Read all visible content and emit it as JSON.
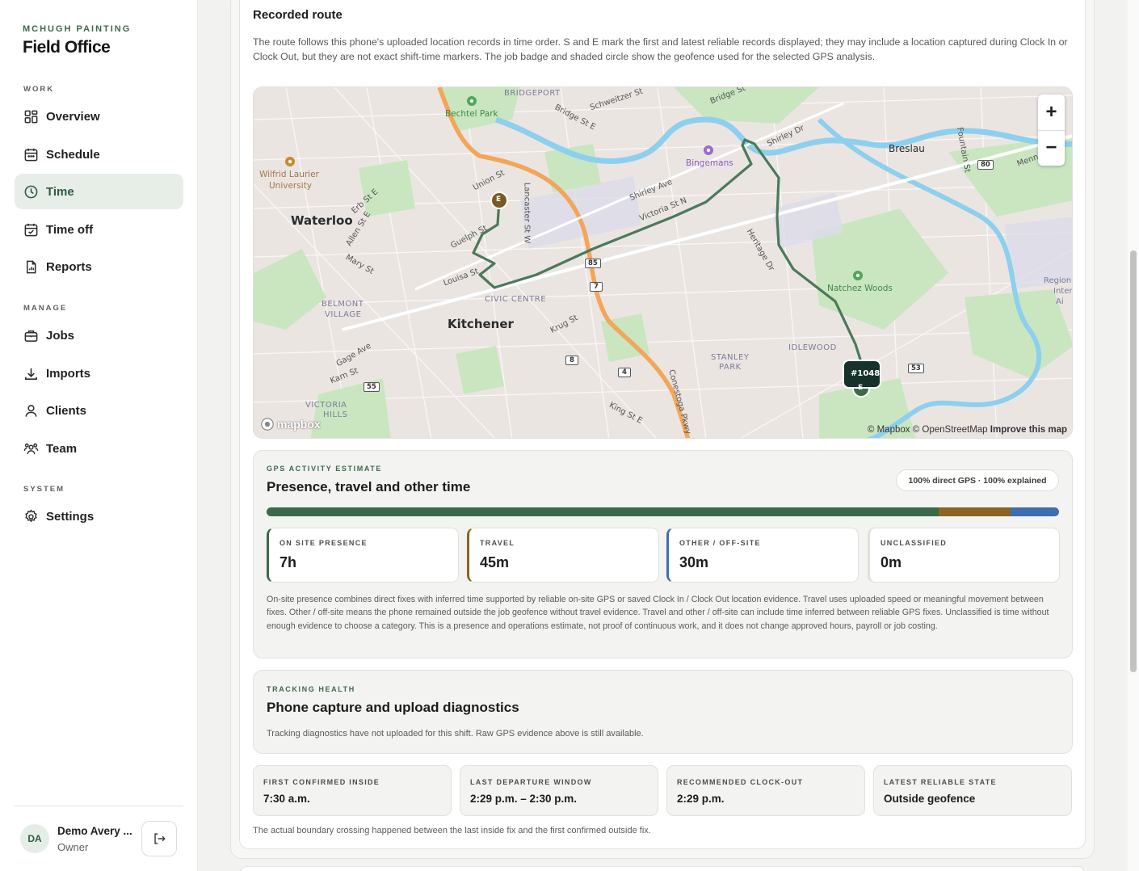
{
  "sidebar": {
    "company": "MCHUGH PAINTING",
    "app_name": "Field Office",
    "sections": {
      "work": "WORK",
      "manage": "MANAGE",
      "system": "SYSTEM"
    },
    "items": {
      "overview": "Overview",
      "schedule": "Schedule",
      "time": "Time",
      "time_off": "Time off",
      "reports": "Reports",
      "jobs": "Jobs",
      "imports": "Imports",
      "clients": "Clients",
      "team": "Team",
      "settings": "Settings"
    },
    "active_item": "time",
    "user": {
      "initials": "DA",
      "name": "Demo Avery ...",
      "role": "Owner"
    },
    "icons": [
      "grid-icon",
      "calendar-icon",
      "clock-icon",
      "calendar-check-icon",
      "report-icon",
      "briefcase-icon",
      "download-icon",
      "user-icon",
      "team-icon",
      "gear-icon",
      "logout-icon"
    ]
  },
  "route": {
    "title": "Recorded route",
    "description": "The route follows this phone's uploaded location records in time order. S and E mark the first and latest reliable records displayed; they may include a location captured during Clock In or Clock Out, but they are not exact shift-time markers. The job badge and shaded circle show the geofence used for the selected GPS analysis."
  },
  "map": {
    "places": {
      "waterloo": "Waterloo",
      "kitchener": "Kitchener",
      "breslau": "Breslau",
      "bridgeport": "BRIDGEPORT",
      "civic_centre": "CIVIC CENTRE",
      "belmont_1": "BELMONT",
      "belmont_2": "VILLAGE",
      "stanley_1": "STANLEY",
      "stanley_2": "PARK",
      "idlewood": "IDLEWOOD",
      "victoria_1": "VICTORIA",
      "victoria_2": "HILLS",
      "laurier_1": "Wilfrid Laurier",
      "laurier_2": "University",
      "bechtel": "Bechtel Park",
      "bingemans": "Bingemans",
      "natchez": "Natchez Woods",
      "region_1": "Region o",
      "region_2": "Inter",
      "region_3": "Ai"
    },
    "streets": {
      "schweitzer": "Schweitzer St",
      "bridge_e": "Bridge St E",
      "bridge": "Bridge St",
      "shirley_dr": "Shirley Dr",
      "shirley_ave": "Shirley Ave",
      "victoria_n": "Victoria St N",
      "union": "Union St",
      "lancaster": "Lancaster St W",
      "erb": "Erb St E",
      "allen": "Allen St E",
      "mary": "Mary St",
      "guelph": "Guelph St",
      "louisa": "Louisa St",
      "heritage": "Heritage Dr",
      "krug": "Krug St",
      "gage": "Gage Ave",
      "karn": "Karn St",
      "king": "King St E",
      "conestoga": "Conestoga Pkwy",
      "fountain": "Fountain St",
      "menno": "Menno St"
    },
    "shields": {
      "r85": "85",
      "r7": "7",
      "r8": "8",
      "r4": "4",
      "r55": "55",
      "r53": "53",
      "r80": "80"
    },
    "job_badge": "#1048",
    "start_marker": "S",
    "end_marker": "E",
    "zoom_in": "+",
    "zoom_out": "−",
    "attribution": {
      "mapbox": "© Mapbox",
      "osm": "© OpenStreetMap",
      "improve": "Improve this map"
    },
    "logo": "mapbox",
    "colors": {
      "route": "#4a7a5a",
      "highway": "#f3a65a",
      "water": "#8cd0ee",
      "park": "#c7e6c0"
    }
  },
  "gps": {
    "kicker": "GPS ACTIVITY ESTIMATE",
    "title": "Presence, travel and other time",
    "badge": "100% direct GPS · 100% explained",
    "bar": [
      {
        "name": "on-site",
        "fraction": 0.8484,
        "color": "#3a6a4a"
      },
      {
        "name": "travel",
        "fraction": 0.0909,
        "color": "#8b6424"
      },
      {
        "name": "other",
        "fraction": 0.0606,
        "color": "#3e6db0"
      }
    ],
    "stats": [
      {
        "label": "ON SITE PRESENCE",
        "value": "7h",
        "color": "#3a6a4a"
      },
      {
        "label": "TRAVEL",
        "value": "45m",
        "color": "#8b6424"
      },
      {
        "label": "OTHER / OFF-SITE",
        "value": "30m",
        "color": "#3e6db0"
      },
      {
        "label": "UNCLASSIFIED",
        "value": "0m",
        "color": "#e0e0dc"
      }
    ],
    "note": "On-site presence combines direct fixes with inferred time supported by reliable on-site GPS or saved Clock In / Clock Out location evidence. Travel uses uploaded speed or meaningful movement between fixes. Other / off-site means the phone remained outside the job geofence without travel evidence. Travel and other / off-site can include time inferred between reliable GPS fixes. Unclassified is time without enough evidence to choose a category. This is a presence and operations estimate, not proof of continuous work, and it does not change approved hours, payroll or job costing."
  },
  "health": {
    "kicker": "TRACKING HEALTH",
    "title": "Phone capture and upload diagnostics",
    "text": "Tracking diagnostics have not uploaded for this shift. Raw GPS evidence above is still available."
  },
  "summary": [
    {
      "label": "FIRST CONFIRMED INSIDE",
      "value": "7:30 a.m."
    },
    {
      "label": "LAST DEPARTURE WINDOW",
      "value": "2:29 p.m. – 2:30 p.m."
    },
    {
      "label": "RECOMMENDED CLOCK-OUT",
      "value": "2:29 p.m."
    },
    {
      "label": "LATEST RELIABLE STATE",
      "value": "Outside geofence"
    }
  ],
  "footnote": "The actual boundary crossing happened between the last inside fix and the first confirmed outside fix."
}
